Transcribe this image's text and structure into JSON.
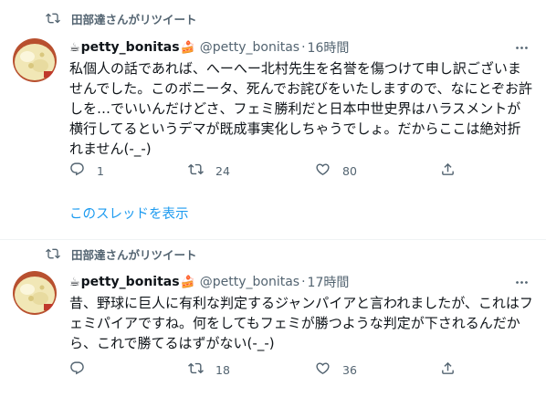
{
  "tweets": [
    {
      "retweeted_by": "田部達さんがリツイート",
      "name": "petty_bonitas",
      "name_prefix_emoji": "☕",
      "name_suffix_emoji": "🍰",
      "handle": "@petty_bonitas",
      "dot": "·",
      "time": "16時間",
      "text": "私個人の話であれば、へーへー北村先生を名誉を傷つけて申し訳ございませんでした。このボニータ、死んでお詫びをいたしますので、なにとぞお許しを…でいいんだけどさ、フェミ勝利だと日本中世史界はハラスメントが横行してるというデマが既成事実化しちゃうでしょ。だからここは絶対折れません(-_-)",
      "reply_count": "1",
      "retweet_count": "24",
      "like_count": "80",
      "thread_link": "このスレッドを表示"
    },
    {
      "retweeted_by": "田部達さんがリツイート",
      "name": "petty_bonitas",
      "name_prefix_emoji": "☕",
      "name_suffix_emoji": "🍰",
      "handle": "@petty_bonitas",
      "dot": "·",
      "time": "17時間",
      "text": "昔、野球に巨人に有利な判定するジャンパイアと言われましたが、これはフェミパイアですね。何をしてもフェミが勝つような判定が下されるんだから、これで勝てるはずがない(-_-)",
      "reply_count": "",
      "retweet_count": "18",
      "like_count": "36"
    }
  ],
  "colors": {
    "text": "#0f1419",
    "secondary": "#536471",
    "link": "#1d9bf0",
    "divider": "#eff3f4"
  },
  "icons": [
    "retweet-icon",
    "more-icon",
    "reply-icon",
    "like-icon",
    "share-icon"
  ]
}
